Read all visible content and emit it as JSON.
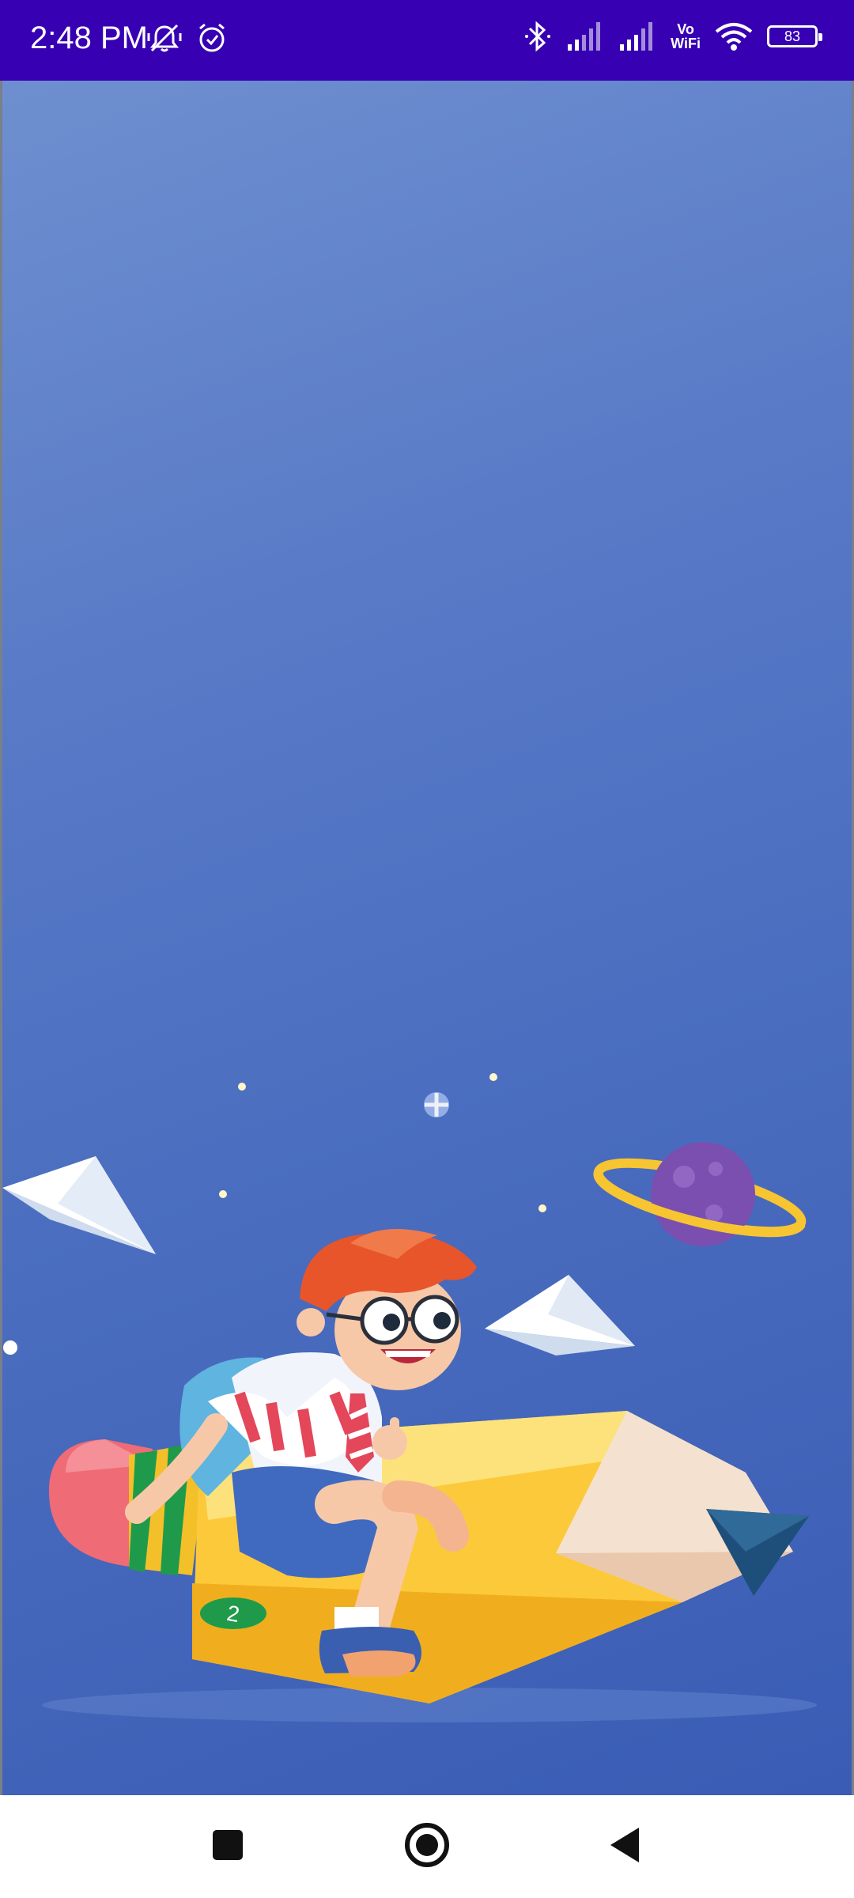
{
  "status_bar": {
    "time": "2:48 PM",
    "battery_level": "83",
    "left_icons": [
      "silent-mode-icon",
      "alarm-icon"
    ],
    "right_icons": [
      "bluetooth-icon",
      "signal-icon",
      "signal-icon",
      "vowifi-icon",
      "wifi-icon",
      "battery-icon"
    ],
    "vowifi_top": "Vo",
    "vowifi_bottom": "WiFi"
  },
  "splash": {
    "illustration": "boy-riding-pencil-rocket",
    "pencil_label": "2",
    "background_colors": [
      "#6e8fcf",
      "#3a5cb4"
    ]
  },
  "nav_bar": {
    "buttons": [
      "recents-button",
      "home-button",
      "back-button"
    ]
  },
  "colors": {
    "status_bar": "#3700b3",
    "pencil_yellow": "#fcc93a",
    "planet_purple": "#7b4fb0",
    "hair_orange": "#e8552a"
  }
}
